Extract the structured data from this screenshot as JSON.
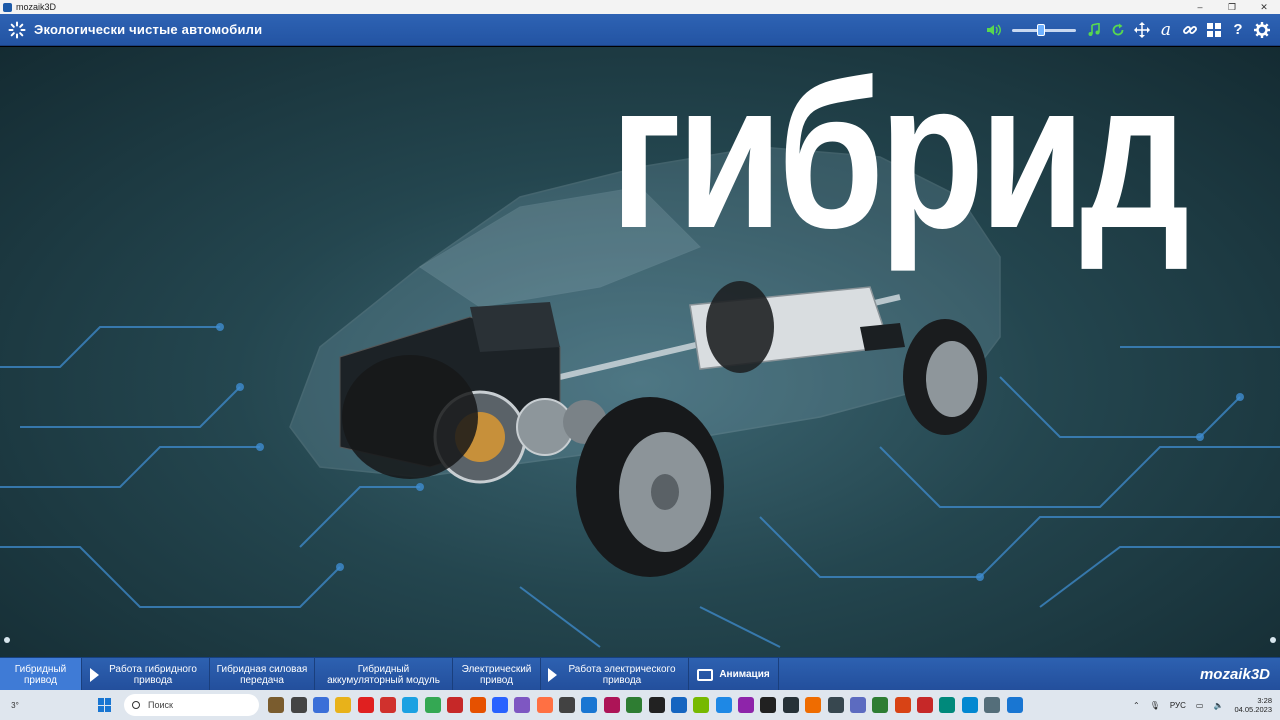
{
  "window": {
    "title": "mozaik3D",
    "minimize": "–",
    "maximize": "❐",
    "close": "✕"
  },
  "header": {
    "title": "Экологически чистые автомобили",
    "volume_level": 0.45,
    "tools": [
      {
        "name": "speaker-icon",
        "glyph": "🔊"
      },
      {
        "name": "music-icon",
        "glyph": "♫"
      },
      {
        "name": "reset-icon",
        "glyph": "↻"
      },
      {
        "name": "move-icon",
        "glyph": "✥"
      },
      {
        "name": "text-icon",
        "glyph": "a"
      },
      {
        "name": "link-icon",
        "glyph": "∞"
      },
      {
        "name": "grid-icon",
        "glyph": "▦"
      },
      {
        "name": "help-icon",
        "glyph": "?"
      },
      {
        "name": "gear-icon",
        "glyph": "⚙"
      }
    ]
  },
  "scene": {
    "big_title": "гибрид"
  },
  "tabs": [
    {
      "label": "Гибридный привод",
      "icon": "",
      "active": true
    },
    {
      "label": "Работа гибридного привода",
      "icon": "play",
      "active": false
    },
    {
      "label": "Гибридная силовая передача",
      "icon": "",
      "active": false
    },
    {
      "label": "Гибридный аккумуляторный модуль",
      "icon": "",
      "active": false
    },
    {
      "label": "Электрический привод",
      "icon": "",
      "active": false
    },
    {
      "label": "Работа электрического привода",
      "icon": "play",
      "active": false
    },
    {
      "label": "Анимация",
      "icon": "tv",
      "active": false
    }
  ],
  "brand": "mozaik3D",
  "taskbar": {
    "weather": "3°",
    "search_placeholder": "Поиск",
    "lang": "РУС",
    "time": "3:28",
    "date": "04.05.2023",
    "app_colors": [
      "#7a5c2e",
      "#444444",
      "#3b6fd8",
      "#e8b21a",
      "#e02020",
      "#d0312d",
      "#1ba1e2",
      "#34a853",
      "#c62828",
      "#e65100",
      "#2962ff",
      "#7e57c2",
      "#ff7043",
      "#424242",
      "#1976d2",
      "#ad1457",
      "#2e7d32",
      "#222222",
      "#1565c0",
      "#76b900",
      "#1e88e5",
      "#8e24aa",
      "#212121",
      "#263238",
      "#ef6c00",
      "#37474f",
      "#5c6bc0",
      "#2e7d32",
      "#d84315",
      "#c62828",
      "#00897b",
      "#0288d1",
      "#546e7a",
      "#1976d2"
    ]
  }
}
